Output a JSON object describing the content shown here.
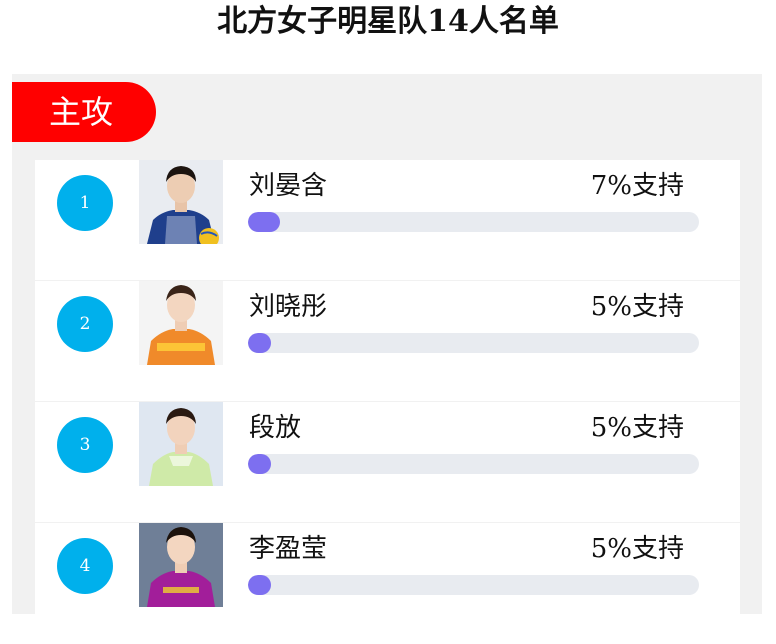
{
  "page": {
    "title": "北方女子明星队14人名单"
  },
  "section": {
    "label": "主攻",
    "accent_color": "#ff0000"
  },
  "colors": {
    "rank_badge": "#00b0ec",
    "progress_fill": "#7d6ff0",
    "progress_track": "#e8ebf0"
  },
  "players": [
    {
      "rank": "1",
      "name": "刘晏含",
      "support_text": "7%支持",
      "support_fraction": 0.07,
      "photo_icon": "player-photo-blue-jersey"
    },
    {
      "rank": "2",
      "name": "刘晓彤",
      "support_text": "5%支持",
      "support_fraction": 0.05,
      "photo_icon": "player-photo-orange-jersey"
    },
    {
      "rank": "3",
      "name": "段放",
      "support_text": "5%支持",
      "support_fraction": 0.05,
      "photo_icon": "player-photo-lightgreen-jersey"
    },
    {
      "rank": "4",
      "name": "李盈莹",
      "support_text": "5%支持",
      "support_fraction": 0.05,
      "photo_icon": "player-photo-purple-jersey"
    }
  ]
}
